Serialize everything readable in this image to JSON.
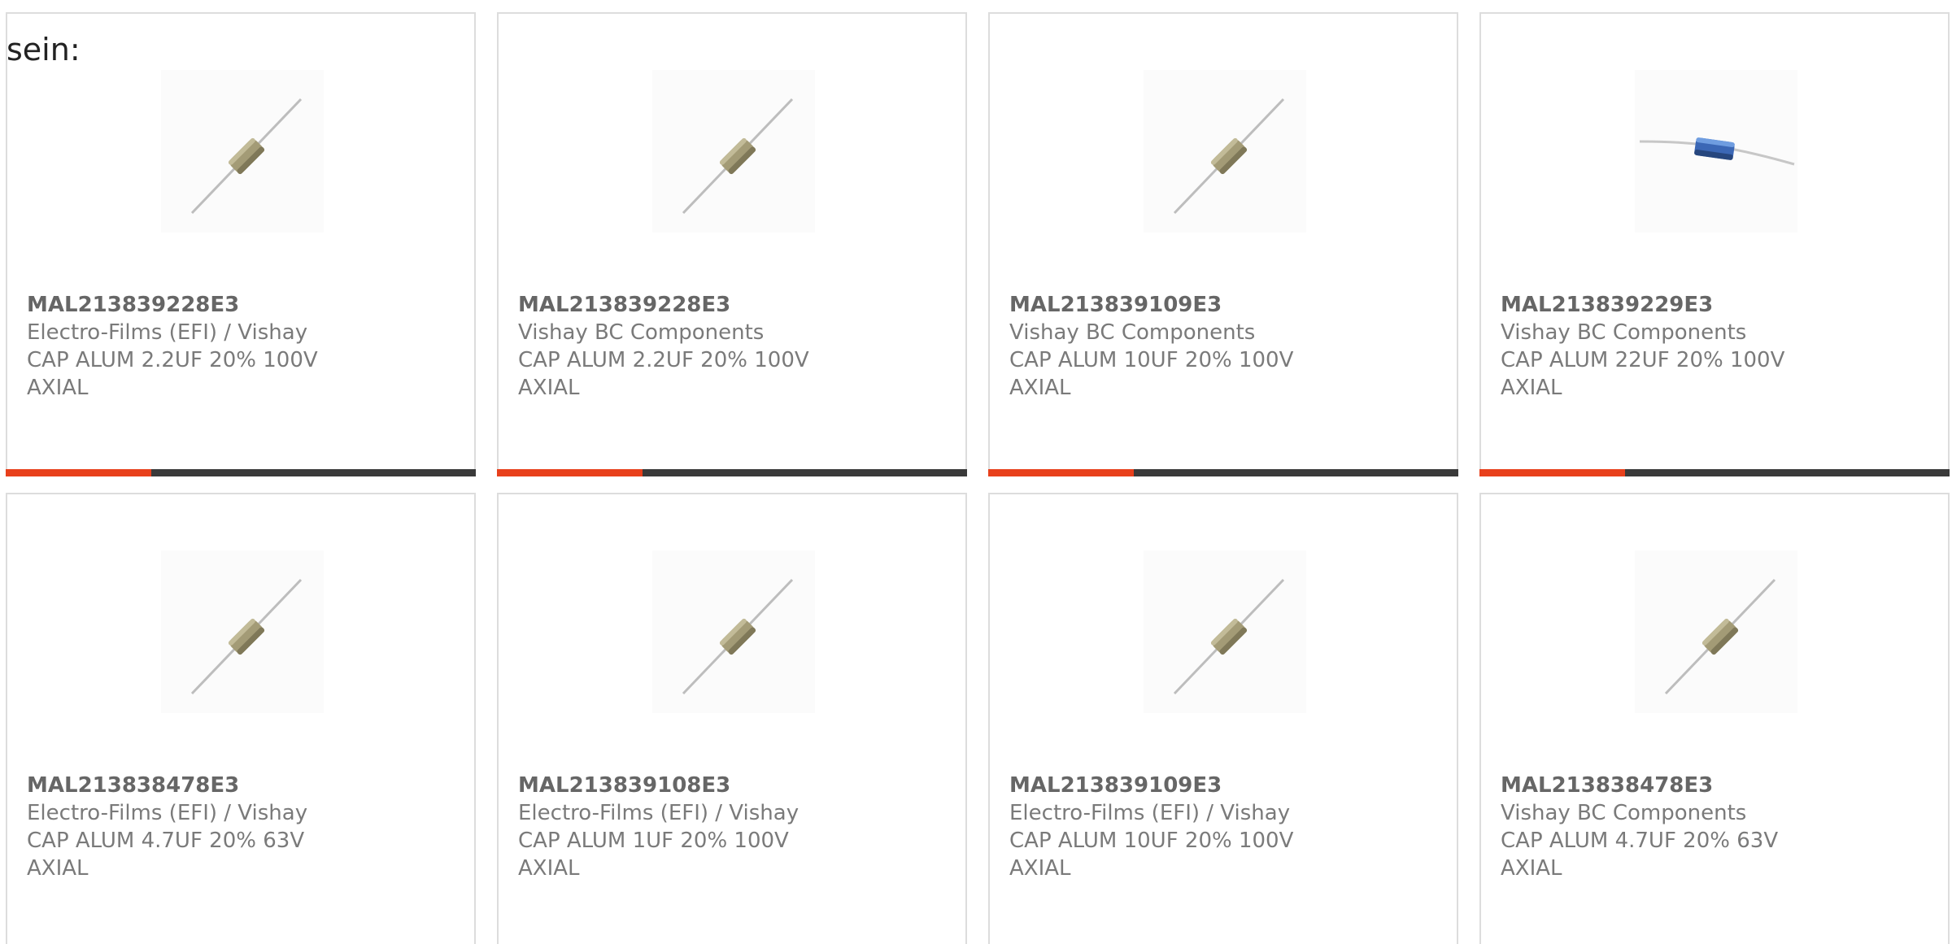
{
  "intro": {
    "text": "sein:"
  },
  "colors": {
    "accent": "#e8401c",
    "progress_track": "#3a3a3a",
    "card_border": "#dddddd",
    "text_muted": "#7a7a7a"
  },
  "products": [
    {
      "part_number": "MAL213839228E3",
      "manufacturer": "Electro-Films (EFI) / Vishay",
      "description": "CAP ALUM 2.2UF 20% 100V AXIAL",
      "icon": "axial-capacitor-beige-icon",
      "progress": 0.31
    },
    {
      "part_number": "MAL213839228E3",
      "manufacturer": "Vishay BC Components",
      "description": "CAP ALUM 2.2UF 20% 100V AXIAL",
      "icon": "axial-capacitor-beige-icon",
      "progress": 0.31
    },
    {
      "part_number": "MAL213839109E3",
      "manufacturer": "Vishay BC Components",
      "description": "CAP ALUM 10UF 20% 100V AXIAL",
      "icon": "axial-capacitor-beige-icon",
      "progress": 0.31
    },
    {
      "part_number": "MAL213839229E3",
      "manufacturer": "Vishay BC Components",
      "description": "CAP ALUM 22UF 20% 100V AXIAL",
      "icon": "axial-capacitor-blue-icon",
      "progress": 0.31
    },
    {
      "part_number": "MAL213838478E3",
      "manufacturer": "Electro-Films (EFI) / Vishay",
      "description": "CAP ALUM 4.7UF 20% 63V AXIAL",
      "icon": "axial-capacitor-beige-icon"
    },
    {
      "part_number": "MAL213839108E3",
      "manufacturer": "Electro-Films (EFI) / Vishay",
      "description": "CAP ALUM 1UF 20% 100V AXIAL",
      "icon": "axial-capacitor-beige-icon"
    },
    {
      "part_number": "MAL213839109E3",
      "manufacturer": "Electro-Films (EFI) / Vishay",
      "description": "CAP ALUM 10UF 20% 100V AXIAL",
      "icon": "axial-capacitor-beige-icon"
    },
    {
      "part_number": "MAL213838478E3",
      "manufacturer": "Vishay BC Components",
      "description": "CAP ALUM 4.7UF 20% 63V AXIAL",
      "icon": "axial-capacitor-beige-icon"
    }
  ]
}
